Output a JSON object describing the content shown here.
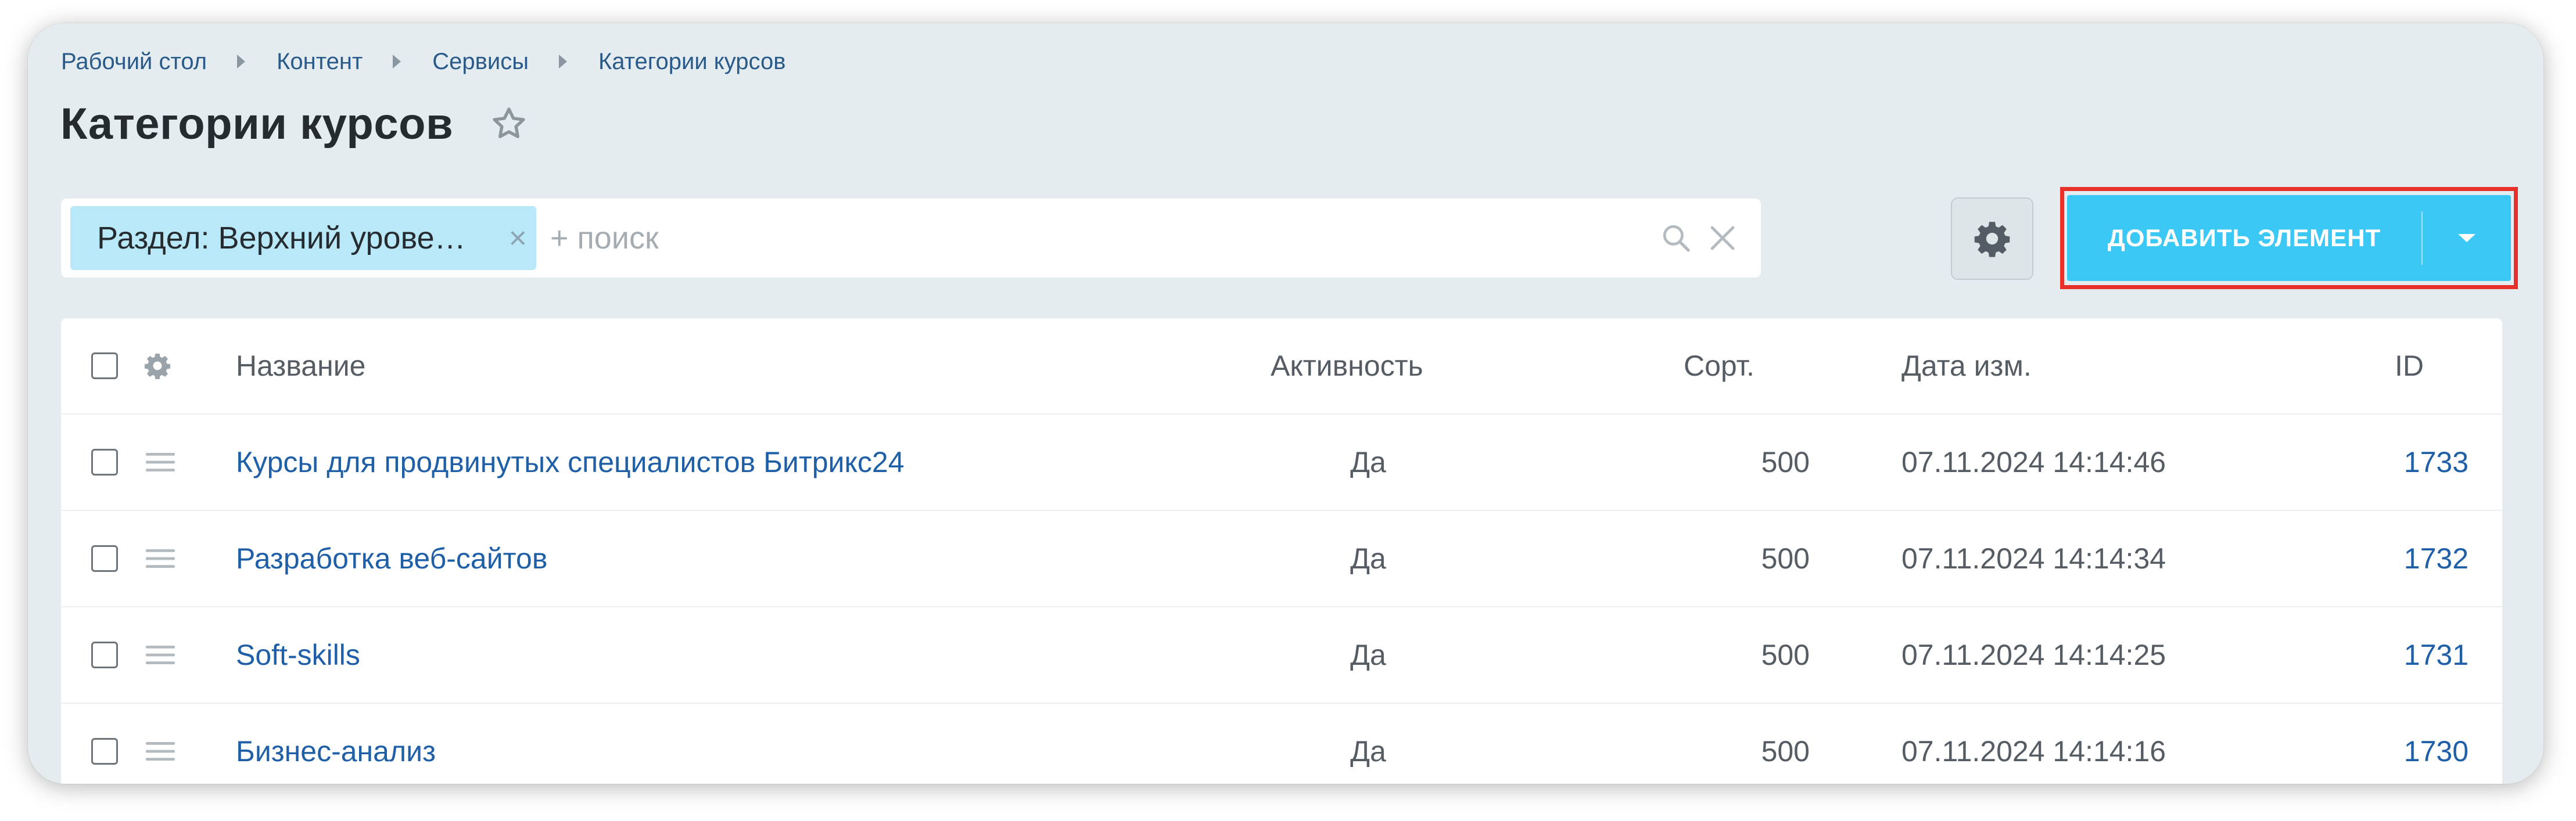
{
  "breadcrumbs": [
    "Рабочий стол",
    "Контент",
    "Сервисы",
    "Категории курсов"
  ],
  "page_title": "Категории курсов",
  "filter": {
    "tag_label": "Раздел: Верхний урове…",
    "tag_close": "×",
    "search_placeholder": "+ поиск"
  },
  "toolbar": {
    "add_button_label": "ДОБАВИТЬ ЭЛЕМЕНТ"
  },
  "table": {
    "columns": {
      "name": "Название",
      "active": "Активность",
      "sort": "Сорт.",
      "date": "Дата изм.",
      "id": "ID"
    },
    "rows": [
      {
        "name": "Курсы для продвинутых специалистов Битрикс24",
        "active": "Да",
        "sort": "500",
        "date": "07.11.2024 14:14:46",
        "id": "1733"
      },
      {
        "name": "Разработка веб-сайтов",
        "active": "Да",
        "sort": "500",
        "date": "07.11.2024 14:14:34",
        "id": "1732"
      },
      {
        "name": "Soft-skills",
        "active": "Да",
        "sort": "500",
        "date": "07.11.2024 14:14:25",
        "id": "1731"
      },
      {
        "name": "Бизнес-анализ",
        "active": "Да",
        "sort": "500",
        "date": "07.11.2024 14:14:16",
        "id": "1730"
      }
    ]
  },
  "colors": {
    "accent_button": "#3bc8f5",
    "link": "#1f5fa8",
    "highlight_frame": "#e8302a",
    "filter_tag": "#b9e9f9",
    "background": "#e4ecef"
  },
  "icons": [
    "star-icon",
    "search-icon",
    "clear-icon",
    "gear-icon",
    "drag-handle-icon",
    "chevron-down-icon"
  ]
}
